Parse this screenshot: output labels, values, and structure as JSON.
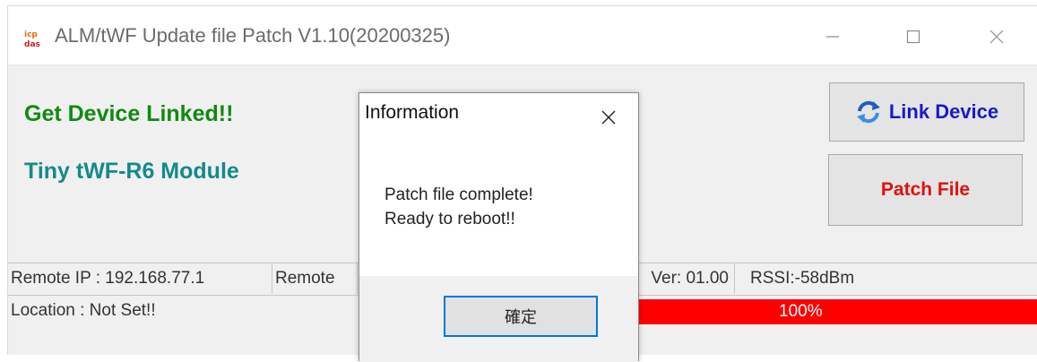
{
  "window": {
    "title": "ALM/tWF Update file Patch V1.10(20200325)",
    "app_icon": "icp-das-logo"
  },
  "main": {
    "status_linked": "Get Device Linked!!",
    "module_name": "Tiny tWF-R6 Module",
    "link_button": "Link Device",
    "link_icon": "refresh-icon",
    "patch_button": "Patch File"
  },
  "statusbar": {
    "remote_ip": "Remote IP : 192.168.77.1",
    "remote": "Remote",
    "ver": "Ver: 01.00",
    "rssi": "RSSI:-58dBm",
    "location": "Location : Not Set!!",
    "progress_text": "100%",
    "progress_value": 100
  },
  "dialog": {
    "title": "Information",
    "line1": "Patch file complete!",
    "line2": "Ready to reboot!!",
    "ok": "確定"
  },
  "colors": {
    "linked": "#108a10",
    "module": "#138a8a",
    "link_text": "#1a1acb",
    "patch_text": "#e01010",
    "progress": "#ff0000"
  }
}
